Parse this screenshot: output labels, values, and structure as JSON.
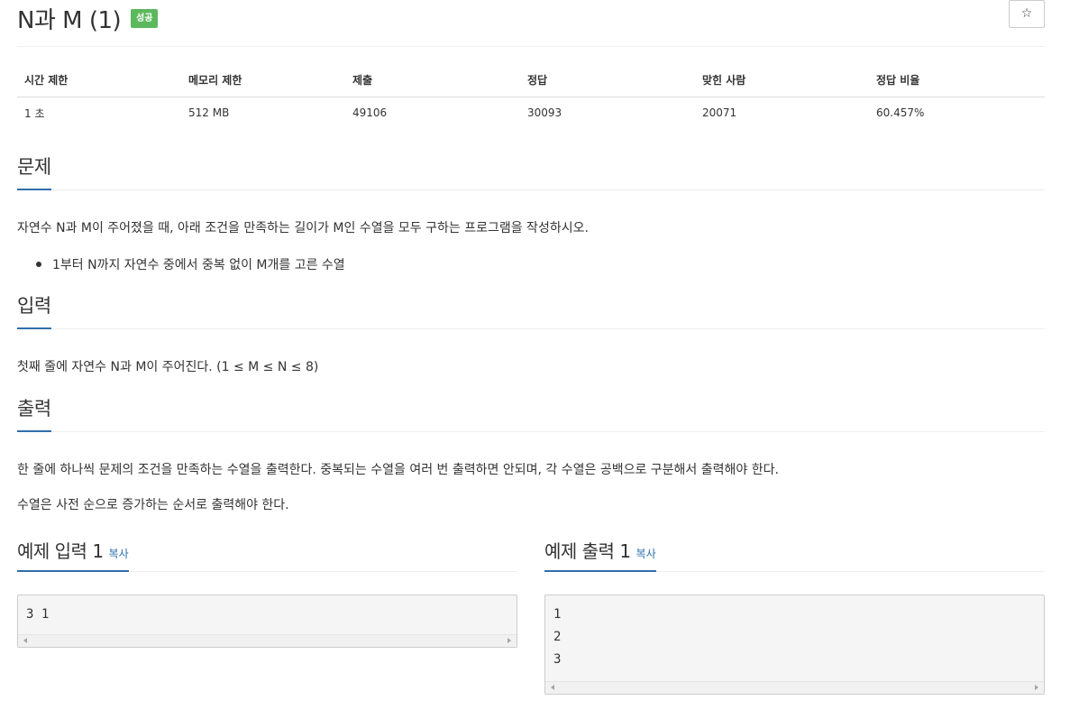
{
  "problem": {
    "title": "N과 M (1)",
    "status_badge": "성공",
    "star_icon": "☆"
  },
  "info_table": {
    "headers": [
      "시간 제한",
      "메모리 제한",
      "제출",
      "정답",
      "맞힌 사람",
      "정답 비율"
    ],
    "values": [
      "1 초",
      "512 MB",
      "49106",
      "30093",
      "20071",
      "60.457%"
    ]
  },
  "sections": {
    "description": {
      "heading": "문제",
      "text": "자연수 N과 M이 주어졌을 때, 아래 조건을 만족하는 길이가 M인 수열을 모두 구하는 프로그램을 작성하시오.",
      "bullets": [
        "1부터 N까지 자연수 중에서 중복 없이 M개를 고른 수열"
      ]
    },
    "input": {
      "heading": "입력",
      "text": "첫째 줄에 자연수 N과 M이 주어진다. (1 ≤ M ≤ N ≤ 8)"
    },
    "output": {
      "heading": "출력",
      "paragraphs": [
        "한 줄에 하나씩 문제의 조건을 만족하는 수열을 출력한다. 중복되는 수열을 여러 번 출력하면 안되며, 각 수열은 공백으로 구분해서 출력해야 한다.",
        "수열은 사전 순으로 증가하는 순서로 출력해야 한다."
      ]
    }
  },
  "samples": {
    "input": {
      "heading": "예제 입력 1",
      "copy_label": "복사",
      "lines": [
        "3 1"
      ]
    },
    "output": {
      "heading": "예제 출력 1",
      "copy_label": "복사",
      "lines": [
        "1",
        "2",
        "3"
      ]
    }
  },
  "colors": {
    "accent": "#2f6fab",
    "badge_success": "#5cb85c",
    "link": "#2a6fad"
  }
}
